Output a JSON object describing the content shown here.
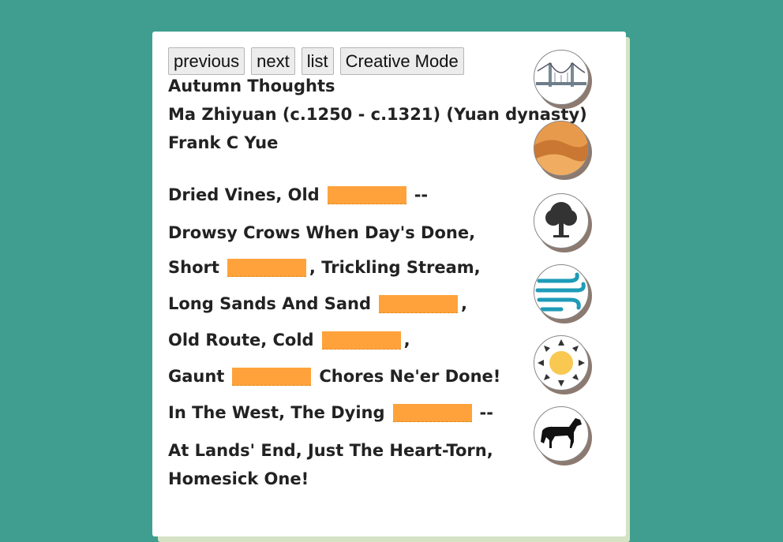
{
  "nav": {
    "previous": "previous",
    "next": "next",
    "list": "list",
    "creative": "Creative Mode"
  },
  "poem": {
    "title": "Autumn Thoughts",
    "author": "Ma Zhiyuan (c.1250 - c.1321) (Yuan dynasty)",
    "translator": "Frank C Yue",
    "lines": [
      {
        "before": "Dried Vines, Old",
        "after": "--"
      },
      {
        "text": "Drowsy Crows When Day's Done,"
      },
      {
        "before": "Short",
        "after": ", Trickling Stream,"
      },
      {
        "before": "Long Sands And Sand",
        "after": ","
      },
      {
        "before": "Old Route, Cold",
        "after": ","
      },
      {
        "before": "Gaunt",
        "after": "Chores Ne'er Done!"
      },
      {
        "before": "In The West, The Dying",
        "after": "--"
      },
      {
        "text": "At Lands' End, Just The Heart-Torn,"
      },
      {
        "text": "Homesick One!"
      }
    ]
  },
  "icons": [
    "bridge-icon",
    "desert-dunes-icon",
    "tree-icon",
    "wind-icon",
    "sun-icon",
    "horse-icon"
  ],
  "colors": {
    "background": "#3f9e8f",
    "blank": "#ffa23b",
    "card": "#ffffff"
  }
}
